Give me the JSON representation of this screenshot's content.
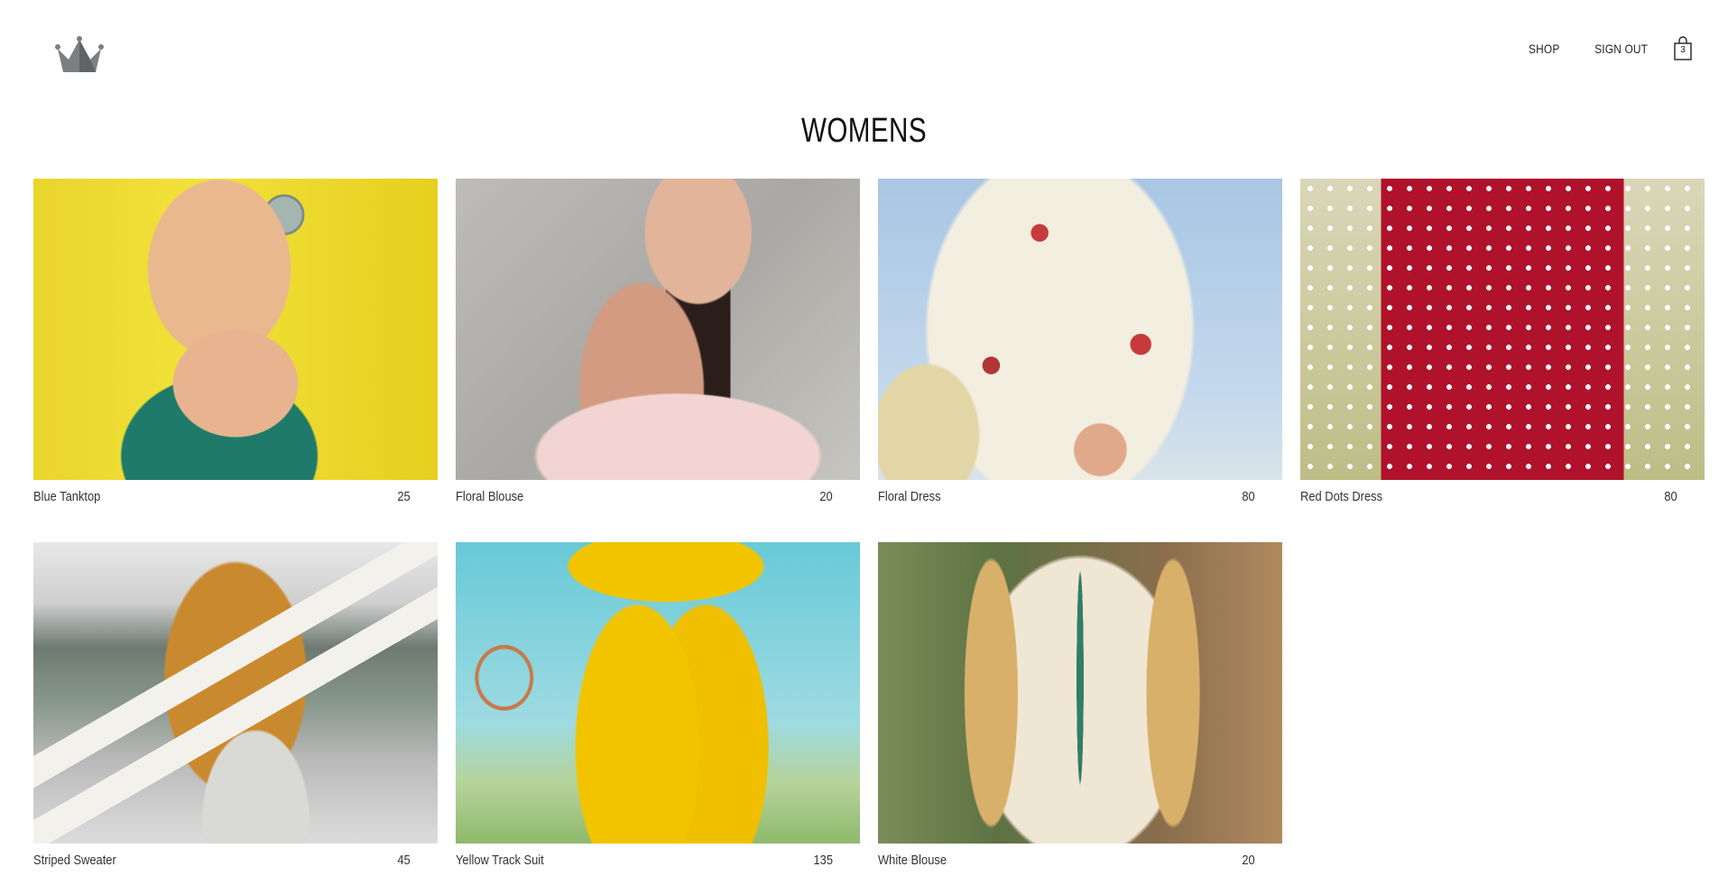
{
  "header": {
    "logo_name": "crown-icon",
    "nav": {
      "shop_label": "SHOP",
      "signout_label": "SIGN OUT"
    },
    "cart": {
      "icon": "shopping-bag-icon",
      "count": "3"
    }
  },
  "page": {
    "title": "WOMENS"
  },
  "products": [
    {
      "name": "Blue Tanktop",
      "price": "25"
    },
    {
      "name": "Floral Blouse",
      "price": "20"
    },
    {
      "name": "Floral Dress",
      "price": "80"
    },
    {
      "name": "Red Dots Dress",
      "price": "80"
    },
    {
      "name": "Striped Sweater",
      "price": "45"
    },
    {
      "name": "Yellow Track Suit",
      "price": "135"
    },
    {
      "name": "White Blouse",
      "price": "20"
    }
  ],
  "colors": {
    "text": "#222222",
    "logo": "#666b6e",
    "background": "#ffffff"
  }
}
